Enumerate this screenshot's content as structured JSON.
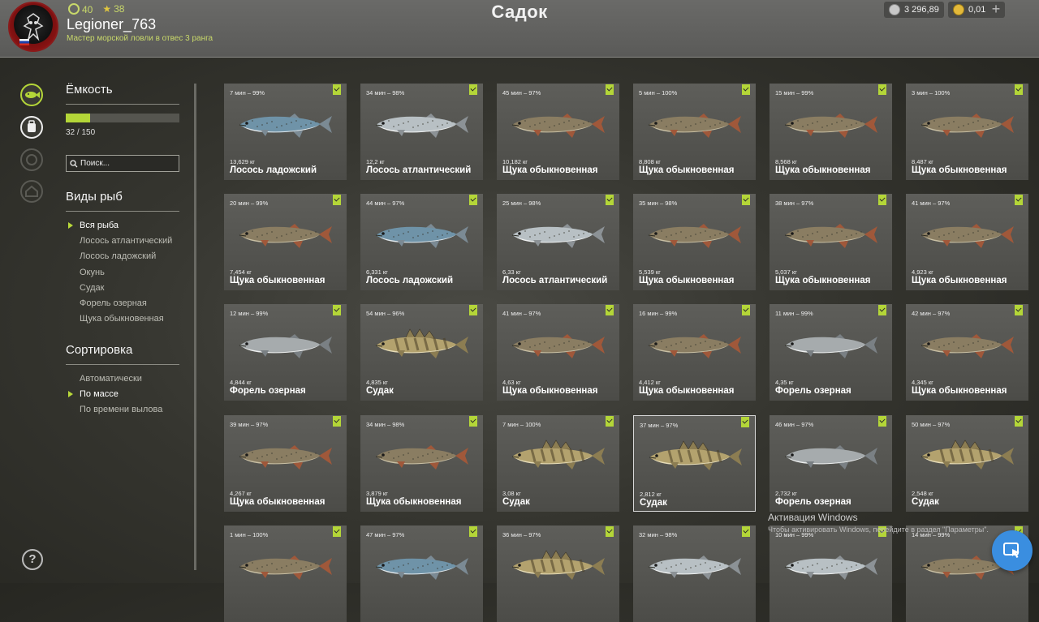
{
  "header": {
    "coins_small": "40",
    "stars": "38",
    "username": "Legioner_763",
    "rank": "Мастер морской ловли в отвес 3 ранга",
    "title": "Садок",
    "silver": "3 296,89",
    "gold": "0,01",
    "plus": "+"
  },
  "sidebar": {
    "capacity_title": "Ёмкость",
    "capacity_text": "32 / 150",
    "capacity_fraction": 0.2133,
    "search_placeholder": "Поиск...",
    "species_title": "Виды рыб",
    "species": [
      {
        "label": "Вся рыба",
        "selected": true
      },
      {
        "label": "Лосось атлантический",
        "selected": false
      },
      {
        "label": "Лосось ладожский",
        "selected": false
      },
      {
        "label": "Окунь",
        "selected": false
      },
      {
        "label": "Судак",
        "selected": false
      },
      {
        "label": "Форель озерная",
        "selected": false
      },
      {
        "label": "Щука обыкновенная",
        "selected": false
      }
    ],
    "sort_title": "Сортировка",
    "sort": [
      {
        "label": "Автоматически",
        "selected": false
      },
      {
        "label": "По массе",
        "selected": true
      },
      {
        "label": "По времени вылова",
        "selected": false
      }
    ],
    "help": "?"
  },
  "fish": [
    {
      "time": "7 мин – 99%",
      "weight": "13,629 кг",
      "name": "Лосось ладожский",
      "kind": "salmon-blue"
    },
    {
      "time": "34 мин – 98%",
      "weight": "12,2 кг",
      "name": "Лосось атлантический",
      "kind": "salmon-silver"
    },
    {
      "time": "45 мин – 97%",
      "weight": "10,182 кг",
      "name": "Щука обыкновенная",
      "kind": "pike"
    },
    {
      "time": "5 мин – 100%",
      "weight": "8,808 кг",
      "name": "Щука обыкновенная",
      "kind": "pike"
    },
    {
      "time": "15 мин – 99%",
      "weight": "8,568 кг",
      "name": "Щука обыкновенная",
      "kind": "pike"
    },
    {
      "time": "3 мин – 100%",
      "weight": "8,487 кг",
      "name": "Щука обыкновенная",
      "kind": "pike"
    },
    {
      "time": "20 мин – 99%",
      "weight": "7,454 кг",
      "name": "Щука обыкновенная",
      "kind": "pike"
    },
    {
      "time": "44 мин – 97%",
      "weight": "6,331 кг",
      "name": "Лосось ладожский",
      "kind": "salmon-blue"
    },
    {
      "time": "25 мин – 98%",
      "weight": "6,33 кг",
      "name": "Лосось атлантический",
      "kind": "salmon-silver"
    },
    {
      "time": "35 мин – 98%",
      "weight": "5,539 кг",
      "name": "Щука обыкновенная",
      "kind": "pike"
    },
    {
      "time": "38 мин – 97%",
      "weight": "5,037 кг",
      "name": "Щука обыкновенная",
      "kind": "pike"
    },
    {
      "time": "41 мин – 97%",
      "weight": "4,923 кг",
      "name": "Щука обыкновенная",
      "kind": "pike"
    },
    {
      "time": "12 мин – 99%",
      "weight": "4,844 кг",
      "name": "Форель озерная",
      "kind": "trout"
    },
    {
      "time": "54 мин – 96%",
      "weight": "4,835 кг",
      "name": "Судак",
      "kind": "zander"
    },
    {
      "time": "41 мин – 97%",
      "weight": "4,63 кг",
      "name": "Щука обыкновенная",
      "kind": "pike"
    },
    {
      "time": "16 мин – 99%",
      "weight": "4,412 кг",
      "name": "Щука обыкновенная",
      "kind": "pike"
    },
    {
      "time": "11 мин – 99%",
      "weight": "4,35 кг",
      "name": "Форель озерная",
      "kind": "trout"
    },
    {
      "time": "42 мин – 97%",
      "weight": "4,345 кг",
      "name": "Щука обыкновенная",
      "kind": "pike"
    },
    {
      "time": "39 мин – 97%",
      "weight": "4,267 кг",
      "name": "Щука обыкновенная",
      "kind": "pike"
    },
    {
      "time": "34 мин – 98%",
      "weight": "3,879 кг",
      "name": "Щука обыкновенная",
      "kind": "pike"
    },
    {
      "time": "7 мин – 100%",
      "weight": "3,08 кг",
      "name": "Судак",
      "kind": "zander"
    },
    {
      "time": "37 мин – 97%",
      "weight": "2,812 кг",
      "name": "Судак",
      "kind": "zander",
      "highlighted": true
    },
    {
      "time": "46 мин – 97%",
      "weight": "2,732 кг",
      "name": "Форель озерная",
      "kind": "trout"
    },
    {
      "time": "50 мин – 97%",
      "weight": "2,548 кг",
      "name": "Судак",
      "kind": "zander"
    },
    {
      "time": "1 мин – 100%",
      "weight": "",
      "name": "",
      "kind": "pike"
    },
    {
      "time": "47 мин – 97%",
      "weight": "",
      "name": "",
      "kind": "salmon-blue"
    },
    {
      "time": "36 мин – 97%",
      "weight": "",
      "name": "",
      "kind": "zander"
    },
    {
      "time": "32 мин – 98%",
      "weight": "",
      "name": "",
      "kind": "salmon-silver"
    },
    {
      "time": "10 мин – 99%",
      "weight": "",
      "name": "",
      "kind": "salmon-silver"
    },
    {
      "time": "14 мин – 99%",
      "weight": "",
      "name": "",
      "kind": "pike"
    }
  ],
  "windows": {
    "title": "Активация Windows",
    "subtitle": "Чтобы активировать Windows, перейдите в раздел \"Параметры\"."
  },
  "icons": {
    "fish_tab": "fish-icon",
    "backpack_tab": "backpack-icon",
    "locked_tab": "locked-icon",
    "home_tab": "home-icon",
    "fab": "screen-cursor-icon"
  },
  "colors": {
    "accent": "#b4d638",
    "fab": "#3a8ee0"
  }
}
